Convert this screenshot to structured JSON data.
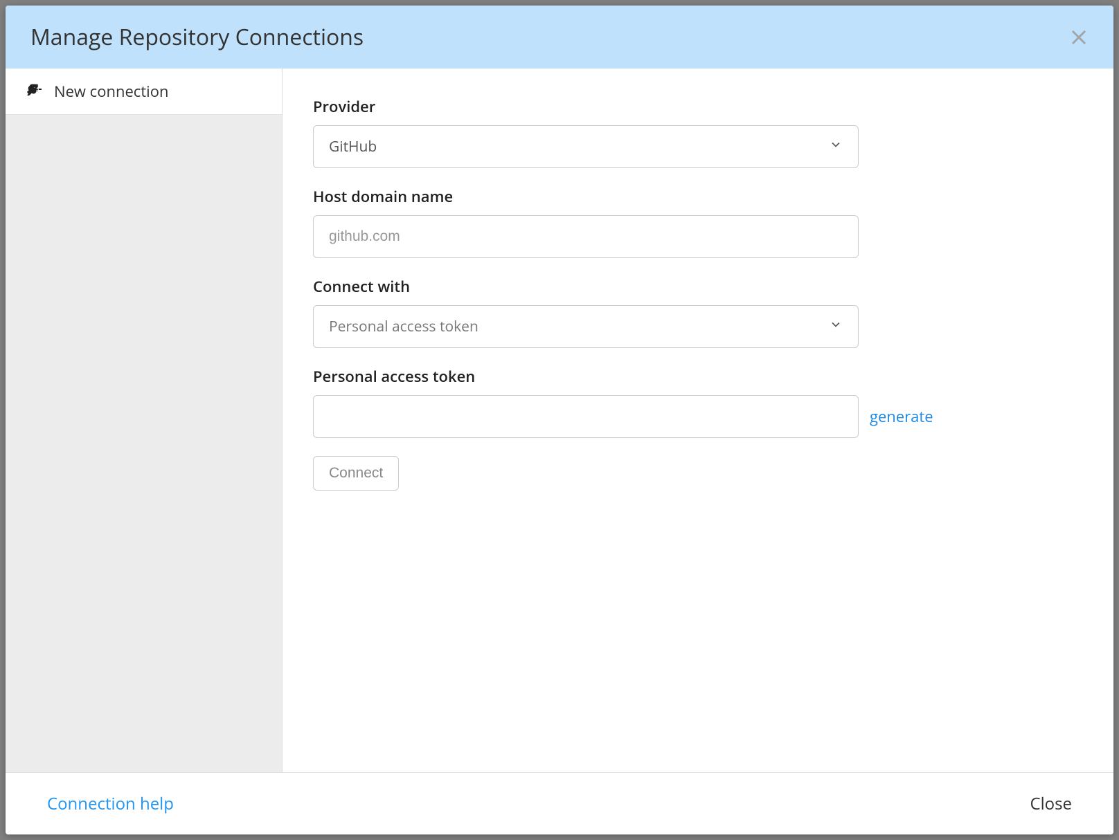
{
  "header": {
    "title": "Manage Repository Connections"
  },
  "sidebar": {
    "items": [
      {
        "label": "New connection"
      }
    ]
  },
  "form": {
    "provider": {
      "label": "Provider",
      "selected": "GitHub"
    },
    "host": {
      "label": "Host domain name",
      "placeholder": "github.com",
      "value": ""
    },
    "connect_with": {
      "label": "Connect with",
      "selected": "Personal access token"
    },
    "token": {
      "label": "Personal access token",
      "value": "",
      "generate_link": "generate"
    },
    "connect_button": "Connect"
  },
  "footer": {
    "help": "Connection help",
    "close": "Close"
  }
}
